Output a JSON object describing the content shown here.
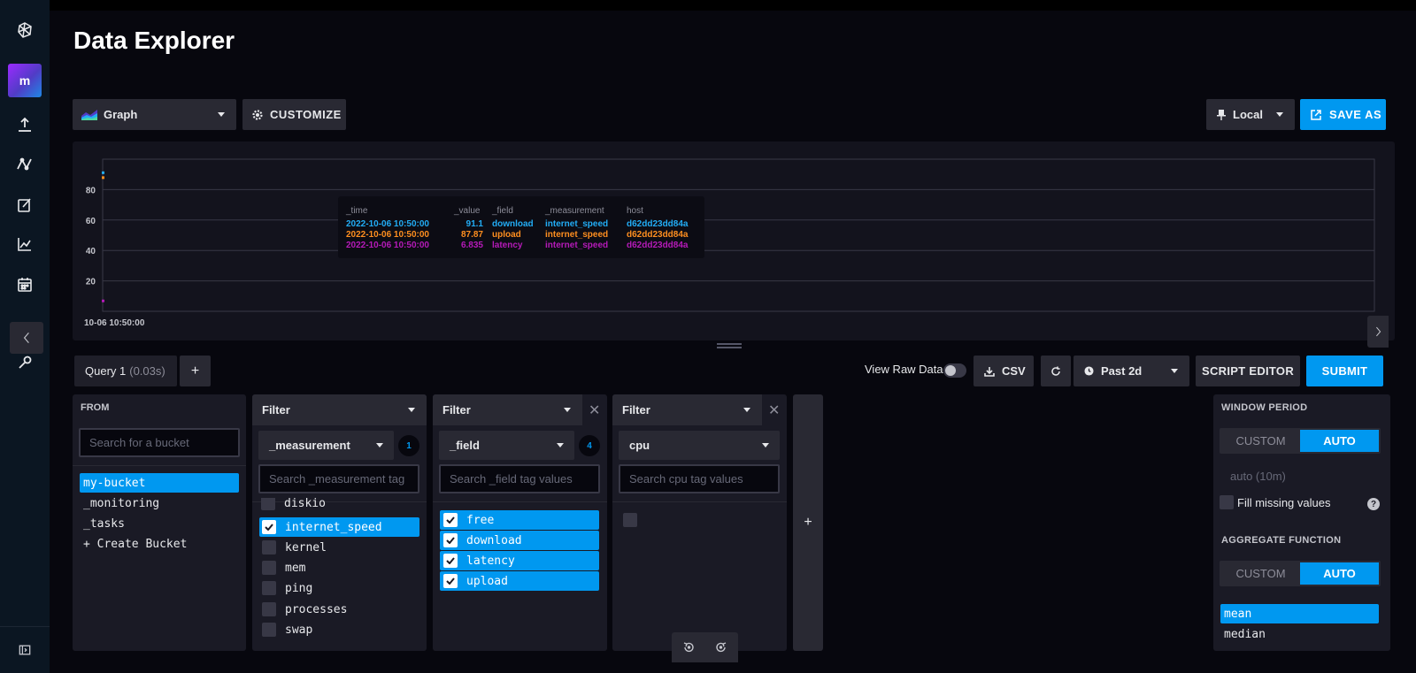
{
  "page": {
    "title": "Data Explorer"
  },
  "sidebar": {
    "org_initial": "m",
    "items": [
      {
        "name": "logo-icon"
      },
      {
        "name": "load-data-icon"
      },
      {
        "name": "data-explorer-icon"
      },
      {
        "name": "notebooks-icon"
      },
      {
        "name": "dashboards-icon"
      },
      {
        "name": "tasks-icon"
      },
      {
        "name": "alerts-icon"
      },
      {
        "name": "settings-icon"
      }
    ]
  },
  "toolbar": {
    "view_type": "Graph",
    "customize_label": "CUSTOMIZE",
    "timezone": "Local",
    "save_as_label": "SAVE AS"
  },
  "graph": {
    "y_ticks": [
      "80",
      "60",
      "40",
      "20"
    ],
    "x_tick": "10-06 10:50:00",
    "tooltip": {
      "headers": [
        "_time",
        "_value",
        "_field",
        "_measurement",
        "host"
      ],
      "rows": [
        {
          "time": "2022-10-06 10:50:00",
          "value": "91.1",
          "field": "download",
          "measurement": "internet_speed",
          "host": "d62dd23dd84a",
          "color": "#22adf6"
        },
        {
          "time": "2022-10-06 10:50:00",
          "value": "87.87",
          "field": "upload",
          "measurement": "internet_speed",
          "host": "d62dd23dd84a",
          "color": "#ff8f1f"
        },
        {
          "time": "2022-10-06 10:50:00",
          "value": "6.835",
          "field": "latency",
          "measurement": "internet_speed",
          "host": "d62dd23dd84a",
          "color": "#b51ab8"
        }
      ]
    }
  },
  "chart_data": {
    "type": "line",
    "x": [
      "2022-10-06 10:50:00"
    ],
    "series": [
      {
        "name": "download",
        "values": [
          91.1
        ]
      },
      {
        "name": "upload",
        "values": [
          87.87
        ]
      },
      {
        "name": "latency",
        "values": [
          6.835
        ]
      }
    ],
    "ylim": [
      0,
      100
    ],
    "grid": true
  },
  "query_bar": {
    "query_name": "Query 1",
    "query_time": "(0.03s)",
    "add_label": "+",
    "view_raw_label": "View Raw Data",
    "csv_label": "CSV",
    "time_range": "Past 2d",
    "script_editor_label": "SCRIPT EDITOR",
    "submit_label": "SUBMIT"
  },
  "from_card": {
    "title": "FROM",
    "search_placeholder": "Search for a bucket",
    "buckets": [
      "my-bucket",
      "_monitoring",
      "_tasks",
      "+ Create Bucket"
    ]
  },
  "filter1": {
    "title": "Filter",
    "key": "_measurement",
    "count": "1",
    "search_placeholder": "Search _measurement tag",
    "partial_item": "diskio",
    "items": [
      {
        "label": "internet_speed",
        "checked": true
      },
      {
        "label": "kernel",
        "checked": false
      },
      {
        "label": "mem",
        "checked": false
      },
      {
        "label": "ping",
        "checked": false
      },
      {
        "label": "processes",
        "checked": false
      },
      {
        "label": "swap",
        "checked": false
      }
    ]
  },
  "filter2": {
    "title": "Filter",
    "key": "_field",
    "count": "4",
    "search_placeholder": "Search _field tag values",
    "items": [
      {
        "label": "free",
        "checked": true
      },
      {
        "label": "download",
        "checked": true
      },
      {
        "label": "latency",
        "checked": true
      },
      {
        "label": "upload",
        "checked": true
      }
    ]
  },
  "filter3": {
    "title": "Filter",
    "key": "cpu",
    "search_placeholder": "Search cpu tag values"
  },
  "add_filter_label": "+",
  "agg": {
    "window_period_title": "WINDOW PERIOD",
    "custom_label": "CUSTOM",
    "auto_label": "AUTO",
    "auto_value": "auto (10m)",
    "fill_missing_label": "Fill missing values",
    "aggregate_title": "AGGREGATE FUNCTION",
    "functions": [
      "mean",
      "median"
    ]
  }
}
